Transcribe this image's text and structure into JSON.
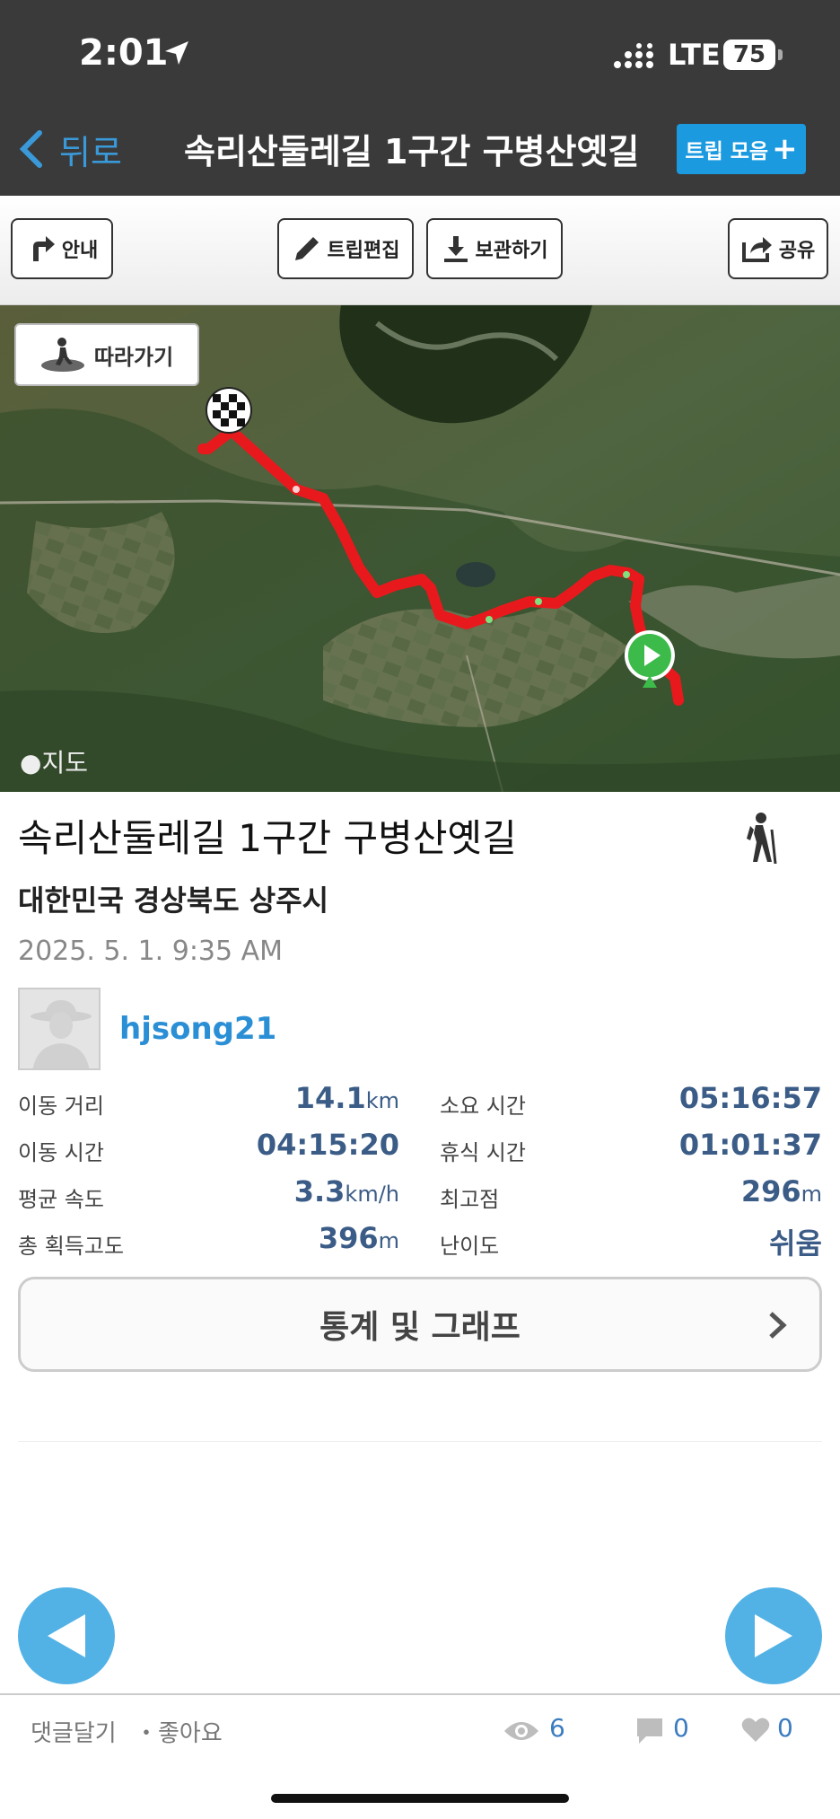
{
  "status": {
    "time": "2:01",
    "network": "LTE",
    "battery": "75"
  },
  "nav": {
    "back_label": "뒤로",
    "title": "속리산둘레길 1구간 구병산옛길",
    "trip_collect_label": "트립 모음"
  },
  "toolbar": {
    "guide_label": "안내",
    "edit_label": "트립편집",
    "save_label": "보관하기",
    "share_label": "공유"
  },
  "map": {
    "follow_label": "따라가기",
    "attribution": "지도",
    "route_color": "#e8191d"
  },
  "trip": {
    "title": "속리산둘레길 1구간 구병산옛길",
    "region": "대한민국 경상북도 상주시",
    "datetime": "2025. 5. 1. 9:35 AM",
    "username": "hjsong21"
  },
  "stats": {
    "distance": {
      "label": "이동 거리",
      "value": "14.1",
      "unit": "km"
    },
    "total_time": {
      "label": "소요 시간",
      "value": "05:16:57"
    },
    "moving_time": {
      "label": "이동 시간",
      "value": "04:15:20"
    },
    "rest_time": {
      "label": "휴식 시간",
      "value": "01:01:37"
    },
    "avg_speed": {
      "label": "평균 속도",
      "value": "3.3",
      "unit": "km/h"
    },
    "max_elevation": {
      "label": "최고점",
      "value": "296",
      "unit": "m"
    },
    "total_ascent": {
      "label": "총 획득고도",
      "value": "396",
      "unit": "m"
    },
    "difficulty": {
      "label": "난이도",
      "value": "쉬움"
    }
  },
  "stats_button_label": "통계 및 그래프",
  "bottom": {
    "comment_label": "댓글달기",
    "like_label": "・좋아요",
    "views": "6",
    "comments": "0",
    "likes": "0"
  }
}
